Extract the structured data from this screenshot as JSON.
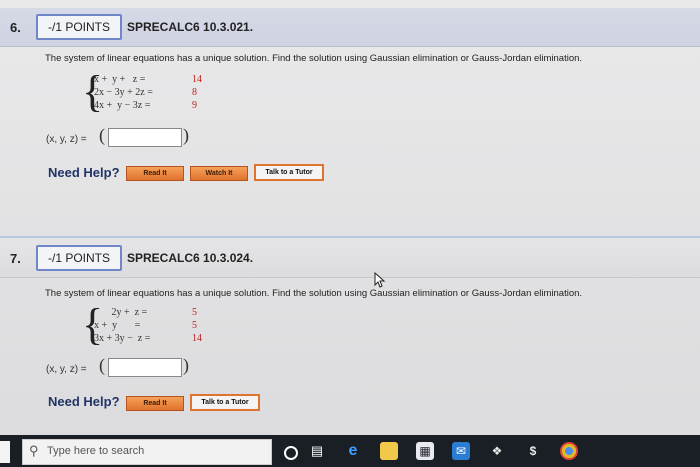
{
  "q6": {
    "number": "6.",
    "points": "-/1 POINTS",
    "code": "SPRECALC6 10.3.021.",
    "prompt": "The system of linear equations has a unique solution. Find the solution using Gaussian elimination or Gauss-Jordan elimination.",
    "equations": [
      {
        "lhs": "x +  y +   z =",
        "rhs": "14"
      },
      {
        "lhs": "2x − 3y + 2z =",
        "rhs": "8"
      },
      {
        "lhs": "4x +  y − 3z =",
        "rhs": "9"
      }
    ],
    "answer_label": "(x, y, z) =",
    "need_help": "Need Help?",
    "buttons": [
      "Read It",
      "Watch It",
      "Talk to a Tutor"
    ]
  },
  "q7": {
    "number": "7.",
    "points": "-/1 POINTS",
    "code": "SPRECALC6 10.3.024.",
    "prompt": "The system of linear equations has a unique solution. Find the solution using Gaussian elimination or Gauss-Jordan elimination.",
    "equations": [
      {
        "lhs": "       2y +  z =",
        "rhs": "5"
      },
      {
        "lhs": "x +  y       =",
        "rhs": "5"
      },
      {
        "lhs": "3x + 3y −  z =",
        "rhs": "14"
      }
    ],
    "answer_label": "(x, y, z) =",
    "need_help": "Need Help?",
    "buttons": [
      "Read It",
      "Talk to a Tutor"
    ]
  },
  "taskbar": {
    "search_placeholder": "Type here to search",
    "icons": [
      "cortana-icon",
      "task-view-icon",
      "edge-icon",
      "file-explorer-icon",
      "store-icon",
      "mail-icon",
      "dropbox-icon",
      "money-icon",
      "chrome-icon"
    ]
  }
}
